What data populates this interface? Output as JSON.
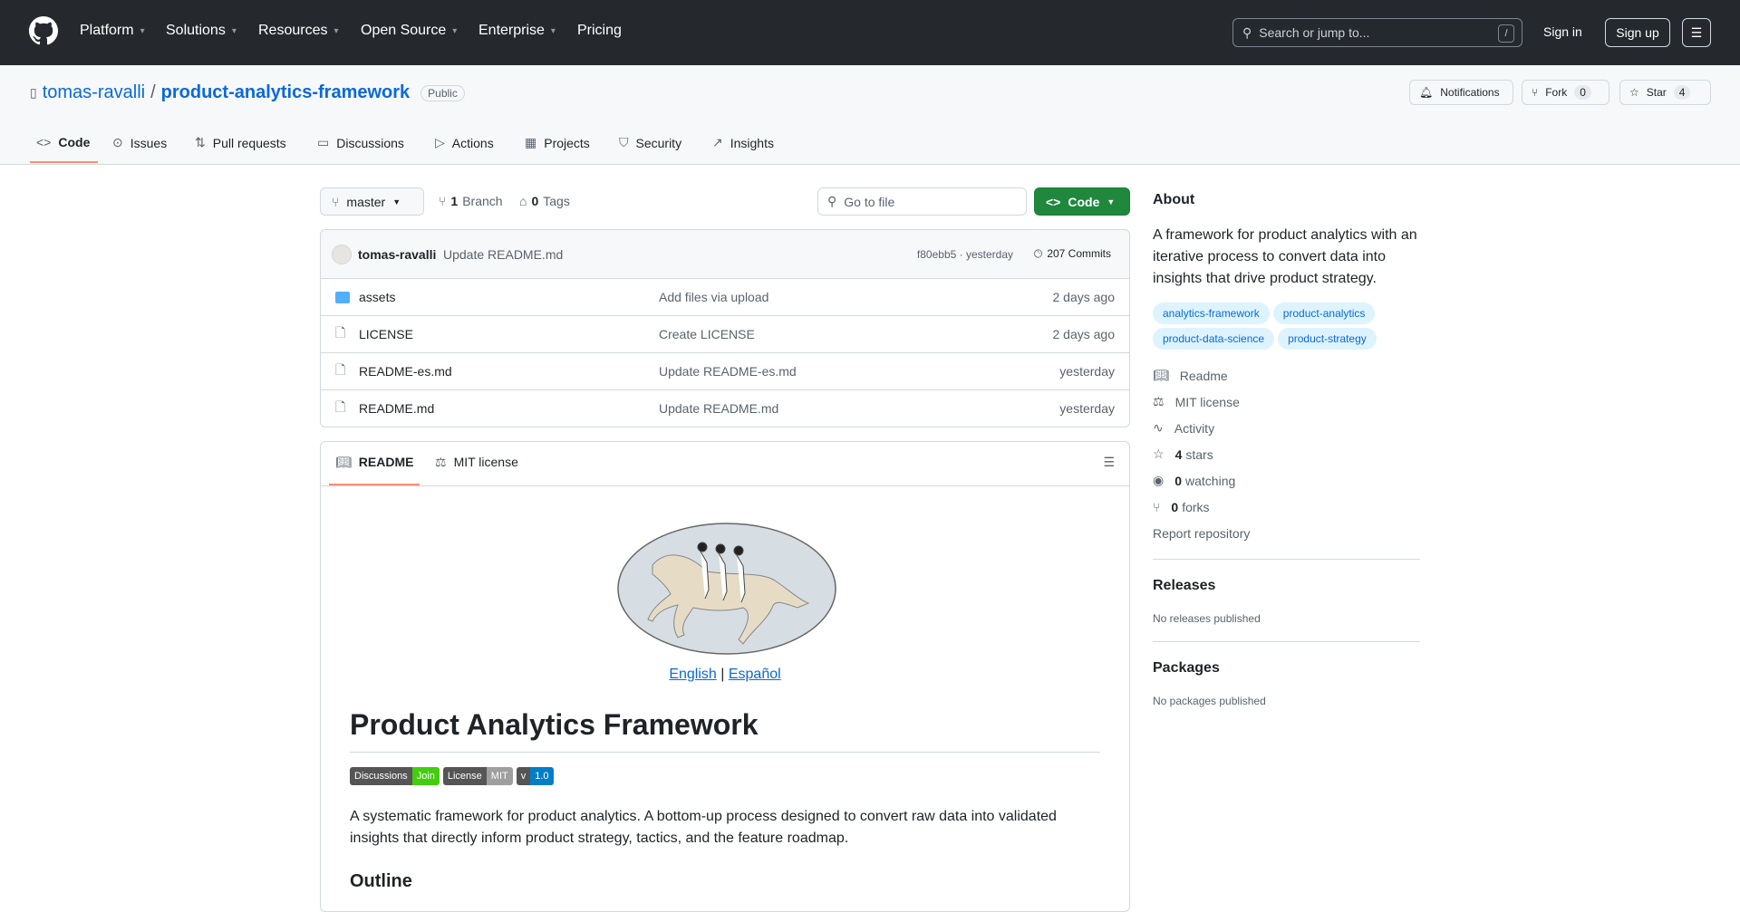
{
  "header": {
    "nav": [
      "Platform",
      "Solutions",
      "Resources",
      "Open Source",
      "Enterprise",
      "Pricing"
    ],
    "search_placeholder": "Search or jump to...",
    "search_key": "/",
    "sign_in": "Sign in",
    "sign_up": "Sign up"
  },
  "repo": {
    "owner": "tomas-ravalli",
    "sep": "/",
    "name": "product-analytics-framework",
    "visibility": "Public",
    "notifications": "Notifications",
    "fork": "Fork",
    "fork_count": "0",
    "star": "Star",
    "star_count": "4"
  },
  "tabs": [
    "Code",
    "Issues",
    "Pull requests",
    "Discussions",
    "Actions",
    "Projects",
    "Security",
    "Insights"
  ],
  "toolbar": {
    "branch": "master",
    "branch_count": "1",
    "branch_label": "Branch",
    "tag_count": "0",
    "tag_label": "Tags",
    "goto_placeholder": "Go to file",
    "code": "Code"
  },
  "commit": {
    "author": "tomas-ravalli",
    "message": "Update README.md",
    "hash": "f80ebb5 · yesterday",
    "commits": "207 Commits"
  },
  "files": [
    {
      "name": "assets",
      "type": "folder",
      "message": "Add files via upload",
      "time": "2 days ago"
    },
    {
      "name": "LICENSE",
      "type": "file",
      "message": "Create LICENSE",
      "time": "2 days ago"
    },
    {
      "name": "README-es.md",
      "type": "file",
      "message": "Update README-es.md",
      "time": "yesterday"
    },
    {
      "name": "README.md",
      "type": "file",
      "message": "Update README.md",
      "time": "yesterday"
    }
  ],
  "readme": {
    "tab_readme": "README",
    "tab_license": "MIT license",
    "lang_en": "English",
    "lang_sep": "|",
    "lang_es": "Español",
    "title": "Product Analytics Framework",
    "badges": [
      {
        "left": "Discussions",
        "right": "Join",
        "color": "#4c1"
      },
      {
        "left": "License",
        "right": "MIT",
        "color": "#9f9f9f"
      },
      {
        "left": "v",
        "right": "1.0",
        "color": "#007ec6"
      }
    ],
    "intro": "A systematic framework for product analytics. A bottom-up process designed to convert raw data into validated insights that directly inform product strategy, tactics, and the feature roadmap.",
    "outline": "Outline"
  },
  "about": {
    "title": "About",
    "description": "A framework for product analytics with an iterative process to convert data into insights that drive product strategy.",
    "topics": [
      "analytics-framework",
      "product-analytics",
      "product-data-science",
      "product-strategy"
    ],
    "readme": "Readme",
    "license": "MIT license",
    "activity": "Activity",
    "stars_n": "4",
    "stars": "stars",
    "watching_n": "0",
    "watching": "watching",
    "forks_n": "0",
    "forks": "forks",
    "report": "Report repository"
  },
  "releases": {
    "title": "Releases",
    "empty": "No releases published"
  },
  "packages": {
    "title": "Packages",
    "empty": "No packages published"
  }
}
